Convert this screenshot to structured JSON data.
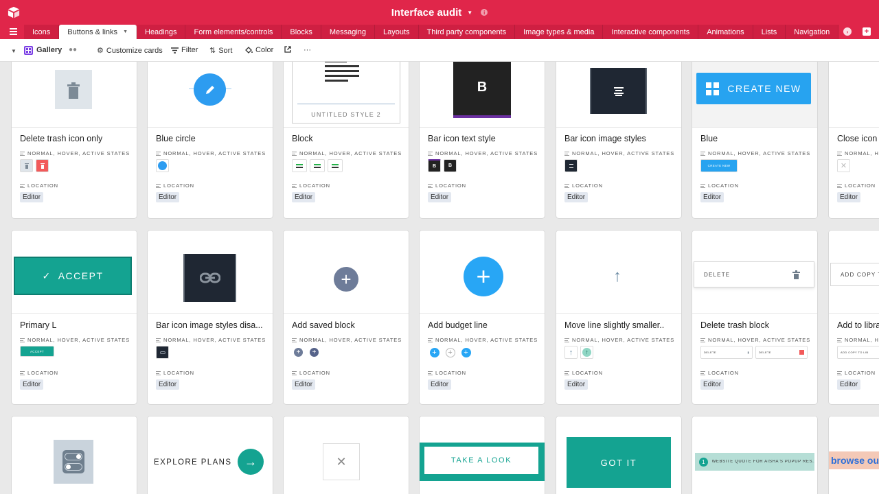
{
  "header": {
    "title": "Interface audit"
  },
  "tabs": [
    {
      "label": "Icons"
    },
    {
      "label": "Buttons & links",
      "active": true
    },
    {
      "label": "Headings"
    },
    {
      "label": "Form elements/controls"
    },
    {
      "label": "Blocks"
    },
    {
      "label": "Messaging"
    },
    {
      "label": "Layouts"
    },
    {
      "label": "Third party components"
    },
    {
      "label": "Image types & media"
    },
    {
      "label": "Interactive components"
    },
    {
      "label": "Animations"
    },
    {
      "label": "Lists"
    },
    {
      "label": "Navigation"
    }
  ],
  "toolbar": {
    "view_name": "Gallery",
    "customize": "Customize cards",
    "filter": "Filter",
    "sort": "Sort",
    "color": "Color",
    "more": "···"
  },
  "field_labels": {
    "states": "NORMAL, HOVER, ACTIVE STATES",
    "location": "LOCATION"
  },
  "colors": {
    "brand": "#e0264a",
    "teal": "#16a091",
    "blue": "#2d9cf0",
    "accent_purple": "#7b3fe4"
  },
  "cards": [
    {
      "title": "Delete trash icon only",
      "location": "Editor"
    },
    {
      "title": "Blue circle",
      "location": "Editor"
    },
    {
      "title": "Block",
      "location": "Editor",
      "thumb_text": "UNTITLED STYLE 2"
    },
    {
      "title": "Bar icon text style",
      "location": "Editor",
      "thumb_text": "B"
    },
    {
      "title": "Bar icon image styles",
      "location": "Editor"
    },
    {
      "title": "Blue",
      "location": "Editor",
      "thumb_text": "CREATE NEW",
      "mini_text": "CREATE NEW"
    },
    {
      "title": "Close icon only",
      "location": "Editor"
    },
    {
      "title": "Primary L",
      "location": "Editor",
      "thumb_text": "ACCEPT",
      "mini_text": "ACCEPT"
    },
    {
      "title": "Bar icon image styles disa...",
      "location": "Editor"
    },
    {
      "title": "Add saved block",
      "location": "Editor"
    },
    {
      "title": "Add budget line",
      "location": "Editor"
    },
    {
      "title": "Move line slightly smaller..",
      "location": "Editor"
    },
    {
      "title": "Delete trash block",
      "location": "Editor",
      "thumb_text": "DELETE",
      "mini_text": "DELETE"
    },
    {
      "title": "Add to library",
      "location": "Editor",
      "thumb_text": "ADD COPY TO",
      "mini_text": "ADD COPY TO LIB"
    },
    {
      "thumb_text": ""
    },
    {
      "thumb_text": "EXPLORE PLANS"
    },
    {
      "thumb_text": ""
    },
    {
      "thumb_text": "TAKE A LOOK"
    },
    {
      "thumb_text": "GOT IT"
    },
    {
      "thumb_text": "WEBSITE QUOTE FOR AISHA'S POPUP RES..."
    },
    {
      "thumb_text": "browse ou"
    }
  ]
}
